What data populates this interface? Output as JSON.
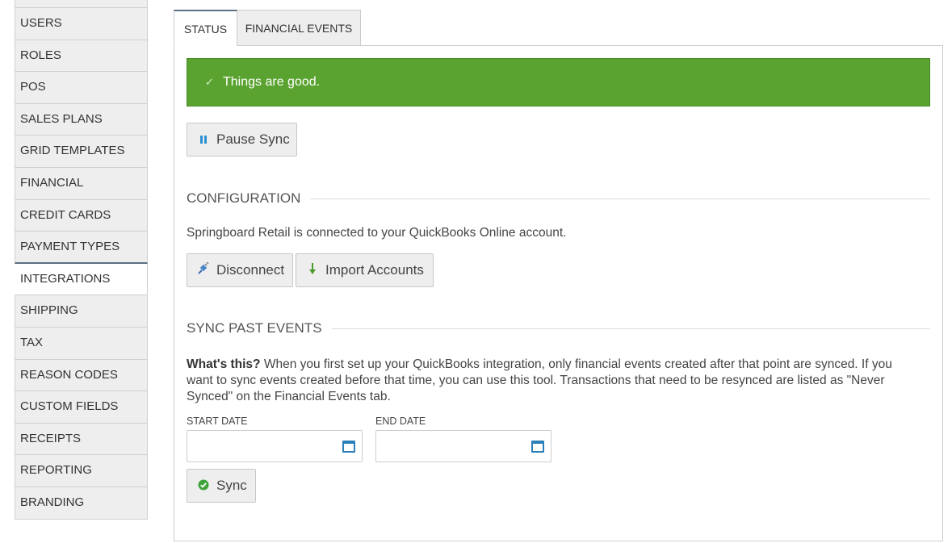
{
  "sidebar": {
    "items": [
      {
        "label": "USERS"
      },
      {
        "label": "ROLES"
      },
      {
        "label": "POS"
      },
      {
        "label": "SALES PLANS"
      },
      {
        "label": "GRID TEMPLATES"
      },
      {
        "label": "FINANCIAL"
      },
      {
        "label": "CREDIT CARDS"
      },
      {
        "label": "PAYMENT TYPES"
      },
      {
        "label": "INTEGRATIONS"
      },
      {
        "label": "SHIPPING"
      },
      {
        "label": "TAX"
      },
      {
        "label": "REASON CODES"
      },
      {
        "label": "CUSTOM FIELDS"
      },
      {
        "label": "RECEIPTS"
      },
      {
        "label": "REPORTING"
      },
      {
        "label": "BRANDING"
      }
    ],
    "active_item": "INTEGRATIONS"
  },
  "tabs": [
    {
      "label": "STATUS",
      "active": true
    },
    {
      "label": "FINANCIAL EVENTS",
      "active": false
    }
  ],
  "status_alert": {
    "icon": "checkmark-icon",
    "text": "Things are good.",
    "color": "#5ba331"
  },
  "pause_button": {
    "icon": "pause-icon",
    "label": "Pause Sync"
  },
  "configuration": {
    "heading": "CONFIGURATION",
    "message": "Springboard Retail is connected to your QuickBooks Online account.",
    "disconnect_label": "Disconnect",
    "disconnect_icon": "plug-icon",
    "import_label": "Import Accounts",
    "import_icon": "arrow-down-icon"
  },
  "sync_past": {
    "heading": "SYNC PAST EVENTS",
    "whats_this": "What's this?",
    "description": " When you first set up your QuickBooks integration, only financial events created after that point are synced. If you want to sync events created before that time, you can use this tool. Transactions that need to be resynced are listed as \"Never Synced\" on the Financial Events tab.",
    "start_label": "START DATE",
    "start_value": "",
    "end_label": "END DATE",
    "end_value": "",
    "sync_label": "Sync",
    "sync_icon": "check-circle-icon"
  },
  "colors": {
    "accent": "#5b7083",
    "success": "#5ba331",
    "calendar": "#2a7fb8"
  }
}
